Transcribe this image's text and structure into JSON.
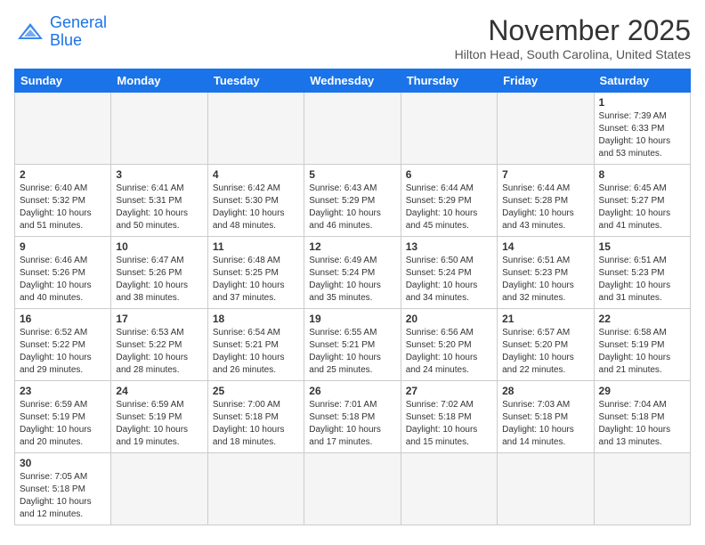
{
  "header": {
    "logo_line1": "General",
    "logo_line2": "Blue",
    "month": "November 2025",
    "location": "Hilton Head, South Carolina, United States"
  },
  "weekdays": [
    "Sunday",
    "Monday",
    "Tuesday",
    "Wednesday",
    "Thursday",
    "Friday",
    "Saturday"
  ],
  "weeks": [
    [
      {
        "day": "",
        "info": ""
      },
      {
        "day": "",
        "info": ""
      },
      {
        "day": "",
        "info": ""
      },
      {
        "day": "",
        "info": ""
      },
      {
        "day": "",
        "info": ""
      },
      {
        "day": "",
        "info": ""
      },
      {
        "day": "1",
        "info": "Sunrise: 7:39 AM\nSunset: 6:33 PM\nDaylight: 10 hours\nand 53 minutes."
      }
    ],
    [
      {
        "day": "2",
        "info": "Sunrise: 6:40 AM\nSunset: 5:32 PM\nDaylight: 10 hours\nand 51 minutes."
      },
      {
        "day": "3",
        "info": "Sunrise: 6:41 AM\nSunset: 5:31 PM\nDaylight: 10 hours\nand 50 minutes."
      },
      {
        "day": "4",
        "info": "Sunrise: 6:42 AM\nSunset: 5:30 PM\nDaylight: 10 hours\nand 48 minutes."
      },
      {
        "day": "5",
        "info": "Sunrise: 6:43 AM\nSunset: 5:29 PM\nDaylight: 10 hours\nand 46 minutes."
      },
      {
        "day": "6",
        "info": "Sunrise: 6:44 AM\nSunset: 5:29 PM\nDaylight: 10 hours\nand 45 minutes."
      },
      {
        "day": "7",
        "info": "Sunrise: 6:44 AM\nSunset: 5:28 PM\nDaylight: 10 hours\nand 43 minutes."
      },
      {
        "day": "8",
        "info": "Sunrise: 6:45 AM\nSunset: 5:27 PM\nDaylight: 10 hours\nand 41 minutes."
      }
    ],
    [
      {
        "day": "9",
        "info": "Sunrise: 6:46 AM\nSunset: 5:26 PM\nDaylight: 10 hours\nand 40 minutes."
      },
      {
        "day": "10",
        "info": "Sunrise: 6:47 AM\nSunset: 5:26 PM\nDaylight: 10 hours\nand 38 minutes."
      },
      {
        "day": "11",
        "info": "Sunrise: 6:48 AM\nSunset: 5:25 PM\nDaylight: 10 hours\nand 37 minutes."
      },
      {
        "day": "12",
        "info": "Sunrise: 6:49 AM\nSunset: 5:24 PM\nDaylight: 10 hours\nand 35 minutes."
      },
      {
        "day": "13",
        "info": "Sunrise: 6:50 AM\nSunset: 5:24 PM\nDaylight: 10 hours\nand 34 minutes."
      },
      {
        "day": "14",
        "info": "Sunrise: 6:51 AM\nSunset: 5:23 PM\nDaylight: 10 hours\nand 32 minutes."
      },
      {
        "day": "15",
        "info": "Sunrise: 6:51 AM\nSunset: 5:23 PM\nDaylight: 10 hours\nand 31 minutes."
      }
    ],
    [
      {
        "day": "16",
        "info": "Sunrise: 6:52 AM\nSunset: 5:22 PM\nDaylight: 10 hours\nand 29 minutes."
      },
      {
        "day": "17",
        "info": "Sunrise: 6:53 AM\nSunset: 5:22 PM\nDaylight: 10 hours\nand 28 minutes."
      },
      {
        "day": "18",
        "info": "Sunrise: 6:54 AM\nSunset: 5:21 PM\nDaylight: 10 hours\nand 26 minutes."
      },
      {
        "day": "19",
        "info": "Sunrise: 6:55 AM\nSunset: 5:21 PM\nDaylight: 10 hours\nand 25 minutes."
      },
      {
        "day": "20",
        "info": "Sunrise: 6:56 AM\nSunset: 5:20 PM\nDaylight: 10 hours\nand 24 minutes."
      },
      {
        "day": "21",
        "info": "Sunrise: 6:57 AM\nSunset: 5:20 PM\nDaylight: 10 hours\nand 22 minutes."
      },
      {
        "day": "22",
        "info": "Sunrise: 6:58 AM\nSunset: 5:19 PM\nDaylight: 10 hours\nand 21 minutes."
      }
    ],
    [
      {
        "day": "23",
        "info": "Sunrise: 6:59 AM\nSunset: 5:19 PM\nDaylight: 10 hours\nand 20 minutes."
      },
      {
        "day": "24",
        "info": "Sunrise: 6:59 AM\nSunset: 5:19 PM\nDaylight: 10 hours\nand 19 minutes."
      },
      {
        "day": "25",
        "info": "Sunrise: 7:00 AM\nSunset: 5:18 PM\nDaylight: 10 hours\nand 18 minutes."
      },
      {
        "day": "26",
        "info": "Sunrise: 7:01 AM\nSunset: 5:18 PM\nDaylight: 10 hours\nand 17 minutes."
      },
      {
        "day": "27",
        "info": "Sunrise: 7:02 AM\nSunset: 5:18 PM\nDaylight: 10 hours\nand 15 minutes."
      },
      {
        "day": "28",
        "info": "Sunrise: 7:03 AM\nSunset: 5:18 PM\nDaylight: 10 hours\nand 14 minutes."
      },
      {
        "day": "29",
        "info": "Sunrise: 7:04 AM\nSunset: 5:18 PM\nDaylight: 10 hours\nand 13 minutes."
      }
    ],
    [
      {
        "day": "30",
        "info": "Sunrise: 7:05 AM\nSunset: 5:18 PM\nDaylight: 10 hours\nand 12 minutes."
      },
      {
        "day": "",
        "info": ""
      },
      {
        "day": "",
        "info": ""
      },
      {
        "day": "",
        "info": ""
      },
      {
        "day": "",
        "info": ""
      },
      {
        "day": "",
        "info": ""
      },
      {
        "day": "",
        "info": ""
      }
    ]
  ]
}
